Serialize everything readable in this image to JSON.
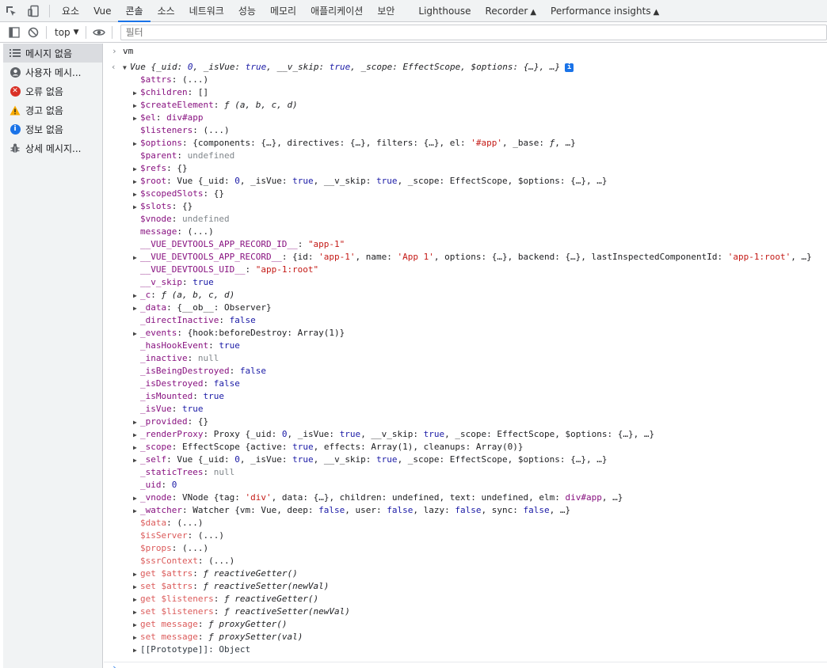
{
  "tabs": [
    "요소",
    "Vue",
    "콘솔",
    "소스",
    "네트워크",
    "성능",
    "메모리",
    "애플리케이션",
    "보안",
    "Lighthouse",
    "Recorder",
    "Performance insights"
  ],
  "active_tab_index": 2,
  "toolbar": {
    "context": "top",
    "filter_placeholder": "필터"
  },
  "sidebar": {
    "items": [
      {
        "label": "메시지 없음",
        "icon": "list-icon"
      },
      {
        "label": "사용자 메시...",
        "icon": "user-icon"
      },
      {
        "label": "오류 없음",
        "icon": "error-icon",
        "color": "#d93025"
      },
      {
        "label": "경고 없음",
        "icon": "warning-icon",
        "color": "#f9ab00"
      },
      {
        "label": "정보 없음",
        "icon": "info-icon",
        "color": "#1a73e8"
      },
      {
        "label": "상세 메시지...",
        "icon": "bug-icon"
      }
    ]
  },
  "console": {
    "input": "vm",
    "header": [
      {
        "t": "Vue {",
        "c": "i"
      },
      {
        "t": "_uid",
        "c": "i"
      },
      {
        "t": ": ",
        "c": "i"
      },
      {
        "t": "0",
        "c": "n i"
      },
      {
        "t": ", _isVue: ",
        "c": "i"
      },
      {
        "t": "true",
        "c": "n i"
      },
      {
        "t": ", __v_skip: ",
        "c": "i"
      },
      {
        "t": "true",
        "c": "n i"
      },
      {
        "t": ", _scope: EffectScope, $options: {…}, …}",
        "c": "i"
      }
    ],
    "lines": [
      [
        {
          "t": "$attrs",
          "c": "k"
        },
        {
          "t": ": (...)"
        }
      ],
      [
        {
          "t": "$children",
          "c": "k"
        },
        {
          "t": ": []"
        }
      ],
      [
        {
          "t": "$createElement",
          "c": "k"
        },
        {
          "t": ": "
        },
        {
          "t": "ƒ (a, b, c, d)",
          "c": "i"
        }
      ],
      [
        {
          "t": "$el",
          "c": "k"
        },
        {
          "t": ": "
        },
        {
          "t": "div#app",
          "c": "k"
        }
      ],
      [
        {
          "t": "$listeners",
          "c": "k"
        },
        {
          "t": ": (...)"
        }
      ],
      [
        {
          "t": "$options",
          "c": "k"
        },
        {
          "t": ": {components: {…}, directives: {…}, filters: {…}, el: "
        },
        {
          "t": "'#app'",
          "c": "s"
        },
        {
          "t": ", _base: "
        },
        {
          "t": "ƒ",
          "c": "i"
        },
        {
          "t": ", …}"
        }
      ],
      [
        {
          "t": "$parent",
          "c": "k"
        },
        {
          "t": ": "
        },
        {
          "t": "undefined",
          "c": "g"
        }
      ],
      [
        {
          "t": "$refs",
          "c": "k"
        },
        {
          "t": ": {}"
        }
      ],
      [
        {
          "t": "$root",
          "c": "k"
        },
        {
          "t": ": Vue {_uid: "
        },
        {
          "t": "0",
          "c": "n"
        },
        {
          "t": ", _isVue: "
        },
        {
          "t": "true",
          "c": "n"
        },
        {
          "t": ", __v_skip: "
        },
        {
          "t": "true",
          "c": "n"
        },
        {
          "t": ", _scope: EffectScope, $options: {…}, …}"
        }
      ],
      [
        {
          "t": "$scopedSlots",
          "c": "k"
        },
        {
          "t": ": {}"
        }
      ],
      [
        {
          "t": "$slots",
          "c": "k"
        },
        {
          "t": ": {}"
        }
      ],
      [
        {
          "t": "$vnode",
          "c": "k"
        },
        {
          "t": ": "
        },
        {
          "t": "undefined",
          "c": "g"
        }
      ],
      [
        {
          "t": "message",
          "c": "k"
        },
        {
          "t": ": (...)"
        }
      ],
      [
        {
          "t": "__VUE_DEVTOOLS_APP_RECORD_ID__",
          "c": "k"
        },
        {
          "t": ": "
        },
        {
          "t": "\"app-1\"",
          "c": "s"
        }
      ],
      [
        {
          "t": "__VUE_DEVTOOLS_APP_RECORD__",
          "c": "k"
        },
        {
          "t": ": {id: "
        },
        {
          "t": "'app-1'",
          "c": "s"
        },
        {
          "t": ", name: "
        },
        {
          "t": "'App 1'",
          "c": "s"
        },
        {
          "t": ", options: {…}, backend: {…}, lastInspectedComponentId: "
        },
        {
          "t": "'app-1:root'",
          "c": "s"
        },
        {
          "t": ", …}"
        }
      ],
      [
        {
          "t": "__VUE_DEVTOOLS_UID__",
          "c": "k"
        },
        {
          "t": ": "
        },
        {
          "t": "\"app-1:root\"",
          "c": "s"
        }
      ],
      [
        {
          "t": "__v_skip",
          "c": "k"
        },
        {
          "t": ": "
        },
        {
          "t": "true",
          "c": "n"
        }
      ],
      [
        {
          "t": "_c",
          "c": "k"
        },
        {
          "t": ": "
        },
        {
          "t": "ƒ (a, b, c, d)",
          "c": "i"
        }
      ],
      [
        {
          "t": "_data",
          "c": "k"
        },
        {
          "t": ": {__ob__: Observer}"
        }
      ],
      [
        {
          "t": "_directInactive",
          "c": "k"
        },
        {
          "t": ": "
        },
        {
          "t": "false",
          "c": "n"
        }
      ],
      [
        {
          "t": "_events",
          "c": "k"
        },
        {
          "t": ": {hook:beforeDestroy: Array(1)}"
        }
      ],
      [
        {
          "t": "_hasHookEvent",
          "c": "k"
        },
        {
          "t": ": "
        },
        {
          "t": "true",
          "c": "n"
        }
      ],
      [
        {
          "t": "_inactive",
          "c": "k"
        },
        {
          "t": ": "
        },
        {
          "t": "null",
          "c": "g"
        }
      ],
      [
        {
          "t": "_isBeingDestroyed",
          "c": "k"
        },
        {
          "t": ": "
        },
        {
          "t": "false",
          "c": "n"
        }
      ],
      [
        {
          "t": "_isDestroyed",
          "c": "k"
        },
        {
          "t": ": "
        },
        {
          "t": "false",
          "c": "n"
        }
      ],
      [
        {
          "t": "_isMounted",
          "c": "k"
        },
        {
          "t": ": "
        },
        {
          "t": "true",
          "c": "n"
        }
      ],
      [
        {
          "t": "_isVue",
          "c": "k"
        },
        {
          "t": ": "
        },
        {
          "t": "true",
          "c": "n"
        }
      ],
      [
        {
          "t": "_provided",
          "c": "k"
        },
        {
          "t": ": {}"
        }
      ],
      [
        {
          "t": "_renderProxy",
          "c": "k"
        },
        {
          "t": ": Proxy {_uid: "
        },
        {
          "t": "0",
          "c": "n"
        },
        {
          "t": ", _isVue: "
        },
        {
          "t": "true",
          "c": "n"
        },
        {
          "t": ", __v_skip: "
        },
        {
          "t": "true",
          "c": "n"
        },
        {
          "t": ", _scope: EffectScope, $options: {…}, …}"
        }
      ],
      [
        {
          "t": "_scope",
          "c": "k"
        },
        {
          "t": ": EffectScope {active: "
        },
        {
          "t": "true",
          "c": "n"
        },
        {
          "t": ", effects: Array(1), cleanups: Array(0)}"
        }
      ],
      [
        {
          "t": "_self",
          "c": "k"
        },
        {
          "t": ": Vue {_uid: "
        },
        {
          "t": "0",
          "c": "n"
        },
        {
          "t": ", _isVue: "
        },
        {
          "t": "true",
          "c": "n"
        },
        {
          "t": ", __v_skip: "
        },
        {
          "t": "true",
          "c": "n"
        },
        {
          "t": ", _scope: EffectScope, $options: {…}, …}"
        }
      ],
      [
        {
          "t": "_staticTrees",
          "c": "k"
        },
        {
          "t": ": "
        },
        {
          "t": "null",
          "c": "g"
        }
      ],
      [
        {
          "t": "_uid",
          "c": "k"
        },
        {
          "t": ": "
        },
        {
          "t": "0",
          "c": "n"
        }
      ],
      [
        {
          "t": "_vnode",
          "c": "k"
        },
        {
          "t": ": VNode {tag: "
        },
        {
          "t": "'div'",
          "c": "s"
        },
        {
          "t": ", data: {…}, children: undefined, text: undefined, elm: "
        },
        {
          "t": "div#app",
          "c": "k"
        },
        {
          "t": ", …}"
        }
      ],
      [
        {
          "t": "_watcher",
          "c": "k"
        },
        {
          "t": ": Watcher {vm: Vue, deep: "
        },
        {
          "t": "false",
          "c": "n"
        },
        {
          "t": ", user: "
        },
        {
          "t": "false",
          "c": "n"
        },
        {
          "t": ", lazy: "
        },
        {
          "t": "false",
          "c": "n"
        },
        {
          "t": ", sync: "
        },
        {
          "t": "false",
          "c": "n"
        },
        {
          "t": ", …}"
        }
      ],
      [
        {
          "t": "$data",
          "c": "kd"
        },
        {
          "t": ": (...)"
        }
      ],
      [
        {
          "t": "$isServer",
          "c": "kd"
        },
        {
          "t": ": (...)"
        }
      ],
      [
        {
          "t": "$props",
          "c": "kd"
        },
        {
          "t": ": (...)"
        }
      ],
      [
        {
          "t": "$ssrContext",
          "c": "kd"
        },
        {
          "t": ": (...)"
        }
      ],
      [
        {
          "t": "get $attrs",
          "c": "kd"
        },
        {
          "t": ": "
        },
        {
          "t": "ƒ reactiveGetter()",
          "c": "i"
        }
      ],
      [
        {
          "t": "set $attrs",
          "c": "kd"
        },
        {
          "t": ": "
        },
        {
          "t": "ƒ reactiveSetter(newVal)",
          "c": "i"
        }
      ],
      [
        {
          "t": "get $listeners",
          "c": "kd"
        },
        {
          "t": ": "
        },
        {
          "t": "ƒ reactiveGetter()",
          "c": "i"
        }
      ],
      [
        {
          "t": "set $listeners",
          "c": "kd"
        },
        {
          "t": ": "
        },
        {
          "t": "ƒ reactiveSetter(newVal)",
          "c": "i"
        }
      ],
      [
        {
          "t": "get message",
          "c": "kd"
        },
        {
          "t": ": "
        },
        {
          "t": "ƒ proxyGetter()",
          "c": "i"
        }
      ],
      [
        {
          "t": "set message",
          "c": "kd"
        },
        {
          "t": ": "
        },
        {
          "t": "ƒ proxySetter(val)",
          "c": "i"
        }
      ],
      [
        {
          "t": "[[Prototype]]: Object",
          "c": "p"
        }
      ]
    ],
    "expandable": [
      false,
      true,
      true,
      true,
      false,
      true,
      false,
      true,
      true,
      true,
      true,
      false,
      false,
      false,
      true,
      false,
      false,
      true,
      true,
      false,
      true,
      false,
      false,
      false,
      false,
      false,
      false,
      true,
      true,
      true,
      true,
      false,
      false,
      true,
      true,
      false,
      false,
      false,
      false,
      true,
      true,
      true,
      true,
      true,
      true,
      true
    ]
  }
}
